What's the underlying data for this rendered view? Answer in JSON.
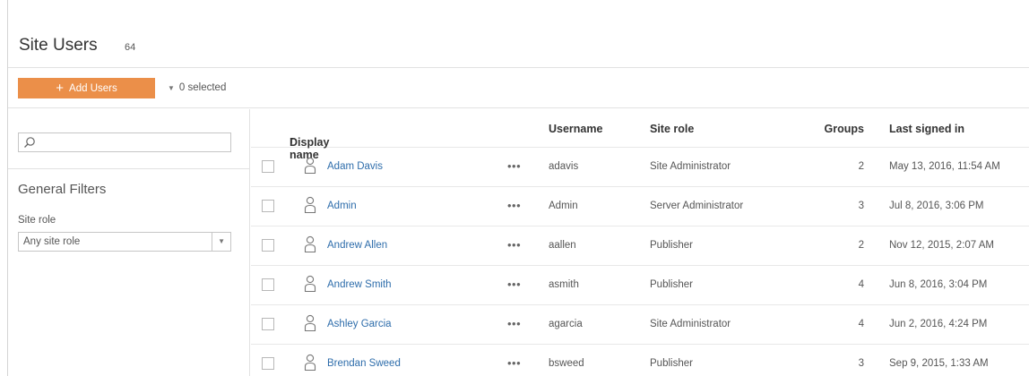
{
  "header": {
    "title": "Site Users",
    "count": "64"
  },
  "toolbar": {
    "add_users_label": "Add Users",
    "selected_label": "0 selected"
  },
  "filters": {
    "search_placeholder": "",
    "heading": "General Filters",
    "site_role_label": "Site role",
    "site_role_value": "Any site role"
  },
  "table": {
    "columns": {
      "display_name": "Display name",
      "username": "Username",
      "site_role": "Site role",
      "groups": "Groups",
      "last_signed_in": "Last signed in"
    },
    "rows": [
      {
        "display_name": "Adam Davis",
        "username": "adavis",
        "site_role": "Site Administrator",
        "groups": "2",
        "last_signed_in": "May 13, 2016, 11:54 AM"
      },
      {
        "display_name": "Admin",
        "username": "Admin",
        "site_role": "Server Administrator",
        "groups": "3",
        "last_signed_in": "Jul 8, 2016, 3:06 PM"
      },
      {
        "display_name": "Andrew Allen",
        "username": "aallen",
        "site_role": "Publisher",
        "groups": "2",
        "last_signed_in": "Nov 12, 2015, 2:07 AM"
      },
      {
        "display_name": "Andrew Smith",
        "username": "asmith",
        "site_role": "Publisher",
        "groups": "4",
        "last_signed_in": "Jun 8, 2016, 3:04 PM"
      },
      {
        "display_name": "Ashley Garcia",
        "username": "agarcia",
        "site_role": "Site Administrator",
        "groups": "4",
        "last_signed_in": "Jun 2, 2016, 4:24 PM"
      },
      {
        "display_name": "Brendan Sweed",
        "username": "bsweed",
        "site_role": "Publisher",
        "groups": "3",
        "last_signed_in": "Sep 9, 2015, 1:33 AM"
      }
    ]
  },
  "icons": {
    "add": "plus-icon",
    "dropdown": "caret-down-icon",
    "search": "search-icon",
    "sort": "sort-ascending-icon",
    "user": "user-icon",
    "more": "more-actions-icon"
  },
  "colors": {
    "accent": "#eb8f49",
    "link": "#2e6dab"
  }
}
